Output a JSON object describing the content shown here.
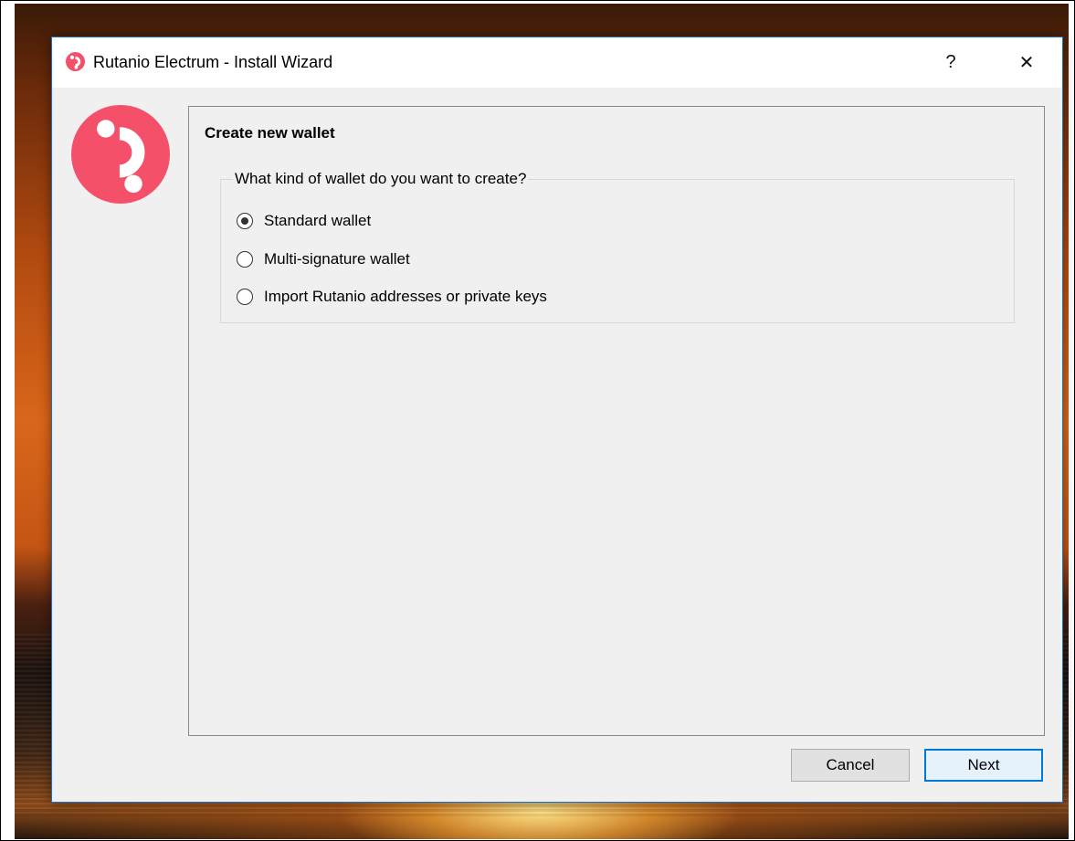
{
  "window": {
    "title": "Rutanio Electrum  -  Install Wizard",
    "help_label": "?",
    "close_label": "✕"
  },
  "colors": {
    "brand": "#f4506a",
    "accent": "#0078d7"
  },
  "page": {
    "heading": "Create new wallet",
    "group_title": "What kind of wallet do you want to create?",
    "options": [
      {
        "label": "Standard wallet",
        "selected": true
      },
      {
        "label": "Multi-signature wallet",
        "selected": false
      },
      {
        "label": "Import Rutanio addresses or private keys",
        "selected": false
      }
    ]
  },
  "buttons": {
    "cancel_label": "Cancel",
    "next_label": "Next"
  }
}
